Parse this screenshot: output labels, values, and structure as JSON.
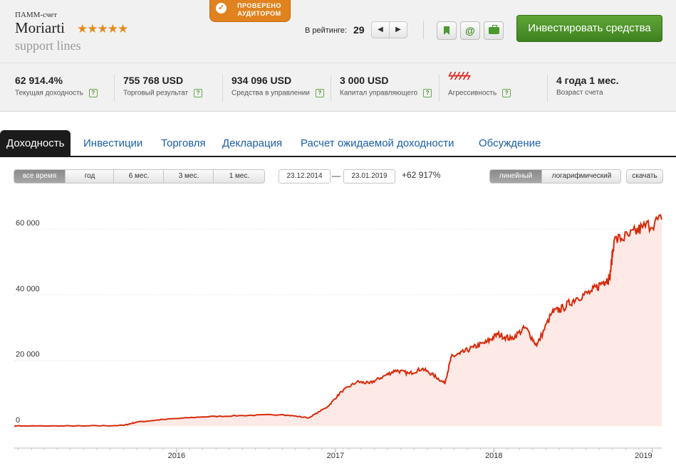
{
  "header": {
    "account_type": "ПАММ-счет",
    "account_name": "Moriarti",
    "subtitle": "support lines",
    "stars": "★★★★★",
    "badge_line1": "ПРОВЕРЕНО",
    "badge_line2": "АУДИТОРОМ",
    "rating_label": "В рейтинге:",
    "rating_value": "29",
    "invest_button": "Инвестировать средства"
  },
  "stats": [
    {
      "value": "62 914.4%",
      "label": "Текущая доходность"
    },
    {
      "value": "755 768 USD",
      "label": "Торговый результат"
    },
    {
      "value": "934 096 USD",
      "label": "Средства в управлении"
    },
    {
      "value": "3 000 USD",
      "label": "Капитал управляющего"
    },
    {
      "value": "ϟϟϟϟϟ",
      "label": "Агрессивность"
    },
    {
      "value": "4 года 1 мес.",
      "label": "Возраст счета"
    }
  ],
  "tabs": [
    "Доходность",
    "Инвестиции",
    "Торговля",
    "Декларация",
    "Расчет ожидаемой доходности",
    "Обсуждение"
  ],
  "controls": {
    "periods": [
      "все время",
      "год",
      "6 мес.",
      "3 мес.",
      "1 мес."
    ],
    "active_period": "все время",
    "date_from": "23.12.2014",
    "date_sep": "—",
    "date_to": "23.01.2019",
    "gain": "+62 917%",
    "scales": [
      "линейный",
      "логарифмический"
    ],
    "active_scale": "линейный",
    "download": "скачать"
  },
  "colors": {
    "line": "#d62a0a",
    "fill": "#fde9e5",
    "accent_green": "#4a9a2d",
    "badge": "#e0821e"
  },
  "chart_data": {
    "type": "area",
    "title": "",
    "xlabel": "",
    "ylabel": "",
    "ylim": [
      0,
      65000
    ],
    "yticks": [
      "0",
      "20 000",
      "40 000",
      "60 000"
    ],
    "xticks": [
      "2016",
      "2017",
      "2018",
      "2019"
    ],
    "grid": true,
    "series": [
      {
        "x": [
          "2014-12-23",
          "2015-03-01",
          "2015-06-01",
          "2015-09-01",
          "2015-10-01",
          "2015-12-01",
          "2016-03-01",
          "2016-06-01",
          "2016-09-01",
          "2016-11-01",
          "2016-12-15",
          "2017-01-15",
          "2017-02-20",
          "2017-03-20",
          "2017-04-20",
          "2017-05-20",
          "2017-06-20",
          "2017-07-20",
          "2017-08-15",
          "2017-09-10",
          "2017-09-25",
          "2017-10-15",
          "2017-11-15",
          "2017-12-15",
          "2018-01-10",
          "2018-02-10",
          "2018-03-15",
          "2018-04-10",
          "2018-05-15",
          "2018-06-10",
          "2018-07-10",
          "2018-08-15",
          "2018-09-10",
          "2018-09-25",
          "2018-10-05",
          "2018-11-10",
          "2018-12-10",
          "2019-01-23"
        ],
        "y": [
          0,
          0,
          0,
          200,
          1200,
          2000,
          2800,
          3200,
          3500,
          2500,
          6000,
          10500,
          13500,
          13000,
          15000,
          17000,
          16000,
          17500,
          15500,
          13000,
          21000,
          22000,
          24000,
          25500,
          28000,
          26500,
          30000,
          24500,
          34500,
          36000,
          39000,
          41000,
          44000,
          45000,
          56500,
          58000,
          60500,
          62917
        ]
      }
    ]
  }
}
